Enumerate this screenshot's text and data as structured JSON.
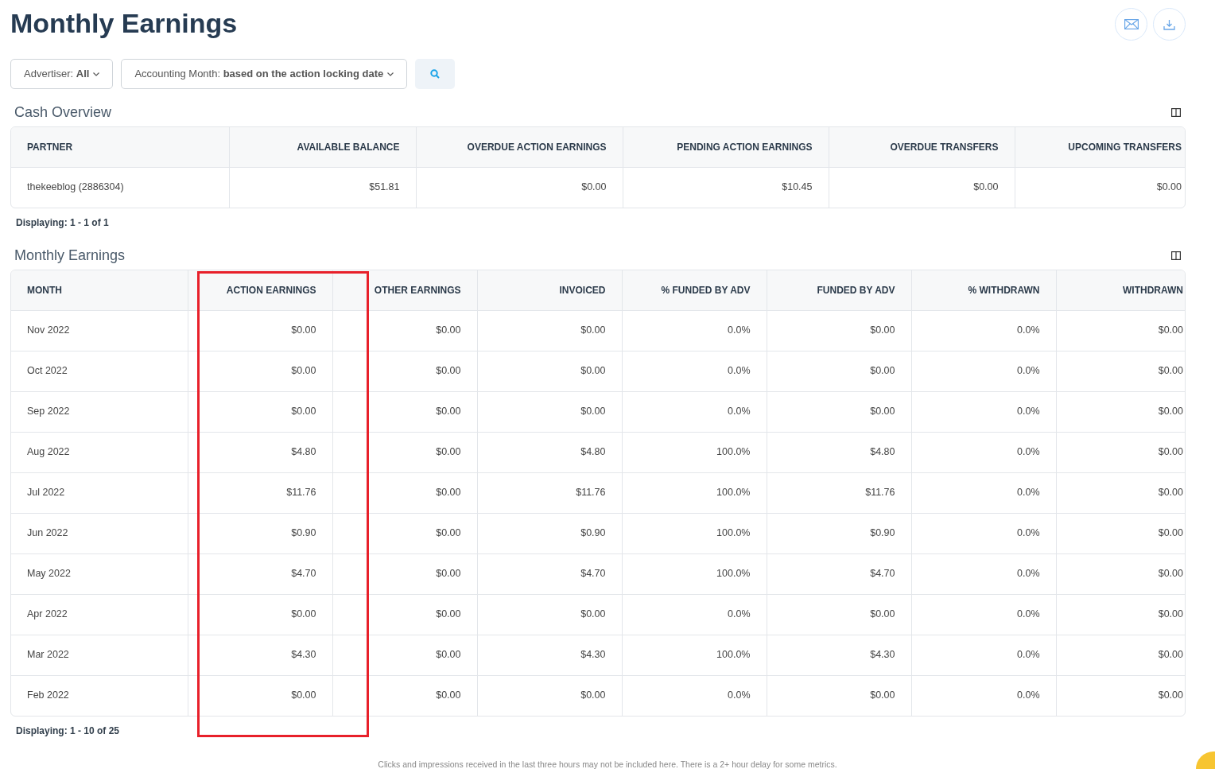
{
  "title": "Monthly Earnings",
  "filters": [
    {
      "label": "Advertiser:",
      "value": "All"
    },
    {
      "label": "Accounting Month:",
      "value": "based on the action locking date"
    }
  ],
  "cash_overview": {
    "title": "Cash Overview",
    "columns": [
      {
        "label": "PARTNER"
      },
      {
        "label": "AVAILABLE BALANCE"
      },
      {
        "label": "OVERDUE ACTION EARNINGS"
      },
      {
        "label": "PENDING ACTION EARNINGS"
      },
      {
        "label": "OVERDUE TRANSFERS"
      },
      {
        "label": "UPCOMING TRANSFERS"
      }
    ],
    "rows": [
      [
        "thekeeblog (2886304)",
        "$51.81",
        "$0.00",
        "$10.45",
        "$0.00",
        "$0.00"
      ]
    ],
    "displaying": "Displaying: 1 - 1 of 1"
  },
  "monthly_earnings": {
    "title": "Monthly Earnings",
    "columns": [
      {
        "label": "MONTH",
        "highlighted": false
      },
      {
        "label": "ACTION EARNINGS",
        "highlighted": true
      },
      {
        "label": "OTHER EARNINGS",
        "highlighted": false
      },
      {
        "label": "INVOICED",
        "highlighted": false
      },
      {
        "label": "% FUNDED BY ADV",
        "highlighted": false
      },
      {
        "label": "FUNDED BY ADV",
        "highlighted": false
      },
      {
        "label": "% WITHDRAWN",
        "highlighted": false
      },
      {
        "label": "WITHDRAWN",
        "highlighted": false
      }
    ],
    "rows": [
      [
        "Nov 2022",
        "$0.00",
        "$0.00",
        "$0.00",
        "0.0%",
        "$0.00",
        "0.0%",
        "$0.00"
      ],
      [
        "Oct 2022",
        "$0.00",
        "$0.00",
        "$0.00",
        "0.0%",
        "$0.00",
        "0.0%",
        "$0.00"
      ],
      [
        "Sep 2022",
        "$0.00",
        "$0.00",
        "$0.00",
        "0.0%",
        "$0.00",
        "0.0%",
        "$0.00"
      ],
      [
        "Aug 2022",
        "$4.80",
        "$0.00",
        "$4.80",
        "100.0%",
        "$4.80",
        "0.0%",
        "$0.00"
      ],
      [
        "Jul 2022",
        "$11.76",
        "$0.00",
        "$11.76",
        "100.0%",
        "$11.76",
        "0.0%",
        "$0.00"
      ],
      [
        "Jun 2022",
        "$0.90",
        "$0.00",
        "$0.90",
        "100.0%",
        "$0.90",
        "0.0%",
        "$0.00"
      ],
      [
        "May 2022",
        "$4.70",
        "$0.00",
        "$4.70",
        "100.0%",
        "$4.70",
        "0.0%",
        "$0.00"
      ],
      [
        "Apr 2022",
        "$0.00",
        "$0.00",
        "$0.00",
        "0.0%",
        "$0.00",
        "0.0%",
        "$0.00"
      ],
      [
        "Mar 2022",
        "$4.30",
        "$0.00",
        "$4.30",
        "100.0%",
        "$4.30",
        "0.0%",
        "$0.00"
      ],
      [
        "Feb 2022",
        "$0.00",
        "$0.00",
        "$0.00",
        "0.0%",
        "$0.00",
        "0.0%",
        "$0.00"
      ]
    ],
    "displaying": "Displaying: 1 - 10 of 25"
  },
  "footer_note": "Clicks and impressions received in the last three hours may not be included here. There is a 2+ hour delay for some metrics."
}
